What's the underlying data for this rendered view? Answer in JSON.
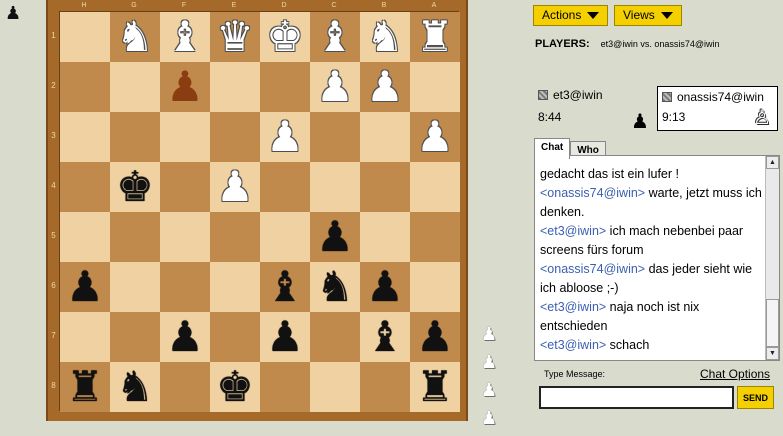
{
  "board": {
    "files": [
      "H",
      "G",
      "F",
      "E",
      "D",
      "C",
      "B",
      "A"
    ],
    "ranks": [
      "1",
      "2",
      "3",
      "4",
      "5",
      "6",
      "7",
      "8"
    ],
    "squares": [
      [
        "",
        "♞",
        "♝",
        "♛",
        "♚",
        "♝",
        "♞",
        "♜"
      ],
      [
        "",
        "",
        "♟",
        "",
        "",
        "♟",
        "♟",
        ""
      ],
      [
        "",
        "",
        "",
        "",
        "♟",
        "",
        "",
        "♟"
      ],
      [
        "",
        "♚",
        "",
        "♟",
        "",
        "",
        "",
        ""
      ],
      [
        "",
        "",
        "",
        "",
        "",
        "♟",
        "",
        ""
      ],
      [
        "♟",
        "",
        "",
        "",
        "♝",
        "♞",
        "♟",
        ""
      ],
      [
        "",
        "",
        "♟",
        "",
        "♟",
        "",
        "♝",
        "♟"
      ],
      [
        "♜",
        "♞",
        "",
        "♚",
        "",
        "",
        "",
        "♜"
      ]
    ],
    "colors": [
      [
        "",
        "w",
        "w",
        "w",
        "w",
        "w",
        "w",
        "w"
      ],
      [
        "",
        "",
        "sel",
        "",
        "",
        "w",
        "w",
        ""
      ],
      [
        "",
        "",
        "",
        "",
        "w",
        "",
        "",
        "w"
      ],
      [
        "",
        "b",
        "",
        "w",
        "",
        "",
        "",
        ""
      ],
      [
        "",
        "",
        "",
        "",
        "",
        "b",
        "",
        ""
      ],
      [
        "b",
        "",
        "",
        "",
        "b",
        "b",
        "b",
        ""
      ],
      [
        "",
        "",
        "b",
        "",
        "b",
        "",
        "b",
        "b"
      ],
      [
        "b",
        "b",
        "",
        "b",
        "",
        "",
        "",
        "b"
      ]
    ],
    "captured": [
      "♟",
      "♟",
      "♟",
      "♟"
    ]
  },
  "corner_icon": "♟",
  "menu": {
    "actions_label": "Actions",
    "views_label": "Views"
  },
  "players": {
    "label": "PLAYERS:",
    "names": "et3@iwin vs. onassis74@iwin",
    "left": {
      "name": "et3@iwin",
      "clock": "8:44"
    },
    "right": {
      "name": "onassis74@iwin",
      "clock": "9:13"
    }
  },
  "tabs": {
    "chat": "Chat",
    "who": "Who"
  },
  "chat": {
    "lines": [
      {
        "nick": "",
        "text": "gedacht das ist ein lufer !"
      },
      {
        "nick": "<onassis74@iwin>",
        "text": " warte, jetzt muss ich denken."
      },
      {
        "nick": "<et3@iwin>",
        "text": " ich mach nebenbei paar screens fürs forum"
      },
      {
        "nick": "<onassis74@iwin>",
        "text": " das jeder sieht wie ich abloose ;-)"
      },
      {
        "nick": "<et3@iwin>",
        "text": " naja noch ist nix entschieden"
      },
      {
        "nick": "<et3@iwin>",
        "text": " schach"
      }
    ],
    "type_label": "Type Message:",
    "options_label": "Chat Options",
    "input_value": "",
    "send_label": "SEND"
  },
  "colors": {
    "accent": "#f5d000",
    "nick": "#3b5fb0",
    "board_light": "#f0d2a2",
    "board_dark": "#c08a4c",
    "frame": "#a5692a"
  }
}
